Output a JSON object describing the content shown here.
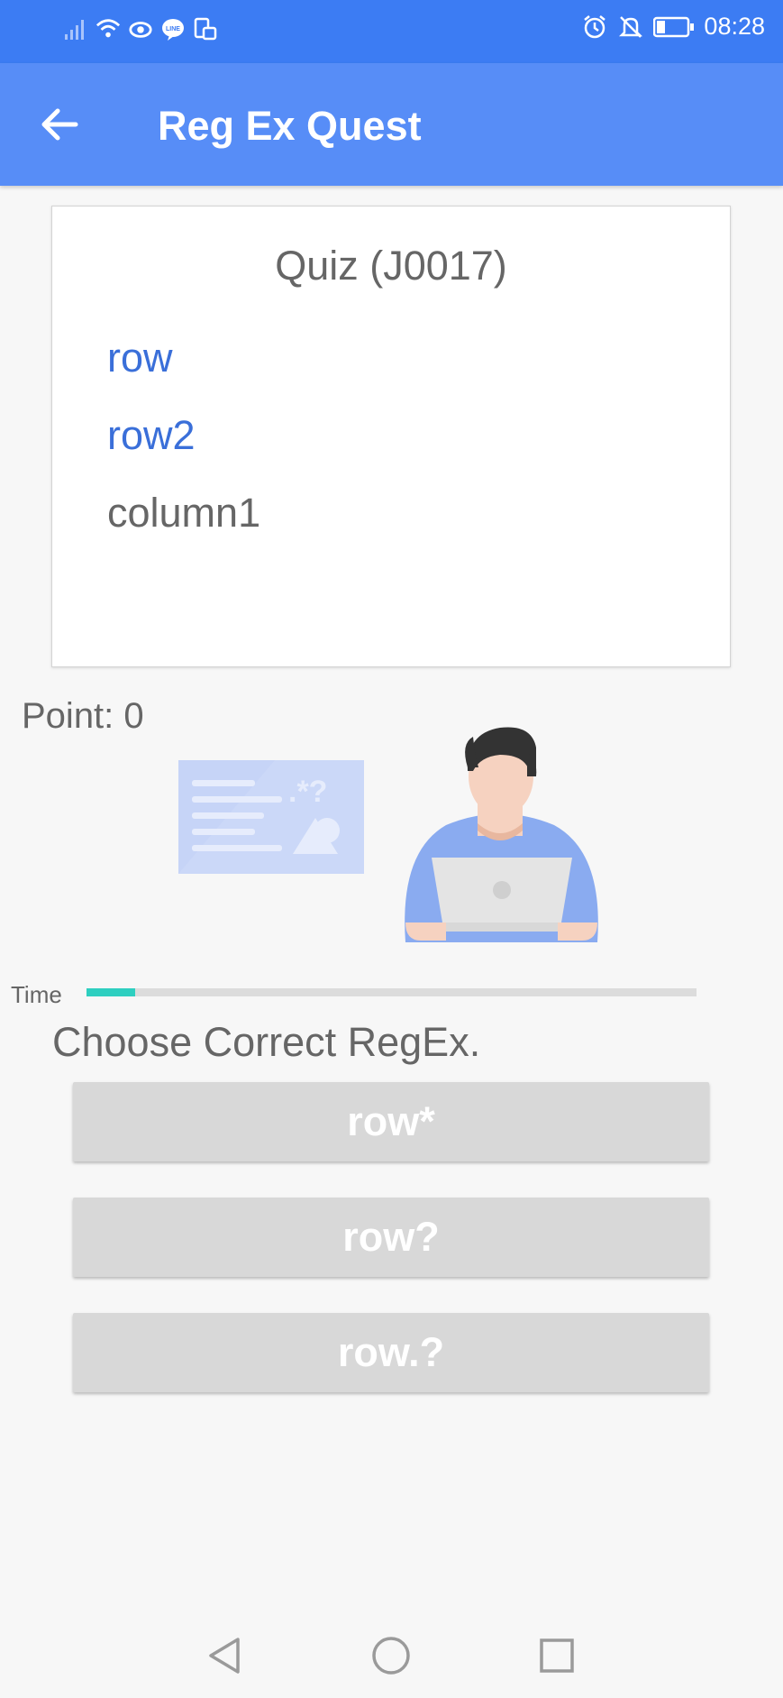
{
  "status_bar": {
    "time": "08:28",
    "left_icons": [
      "signal-icon",
      "wifi-icon",
      "eye-icon",
      "line-icon",
      "sim-icon"
    ],
    "right_icons": [
      "alarm-icon",
      "mute-icon",
      "battery-icon"
    ]
  },
  "app_bar": {
    "title": "Reg Ex Quest",
    "back_icon": "arrow-left-icon"
  },
  "quiz": {
    "title": "Quiz  (J0017)",
    "lines": [
      {
        "text": "row",
        "matched": true
      },
      {
        "text": "row2",
        "matched": true
      },
      {
        "text": "column1",
        "matched": false
      }
    ]
  },
  "score": {
    "label": "Point: 0"
  },
  "timer": {
    "label": "Time",
    "progress": 0.08
  },
  "question": {
    "prompt": "Choose Correct RegEx."
  },
  "answers": [
    {
      "label": "row*"
    },
    {
      "label": "row?"
    },
    {
      "label": "row.?"
    }
  ],
  "nav_bar": {
    "icons": [
      "nav-back-icon",
      "nav-home-icon",
      "nav-recents-icon"
    ]
  },
  "colors": {
    "status_bar": "#3c7cf3",
    "app_bar": "#578df7",
    "matched_text": "#3a6fd9",
    "timer_fill": "#2ecfc0",
    "answer_button": "#d8d8d8"
  }
}
